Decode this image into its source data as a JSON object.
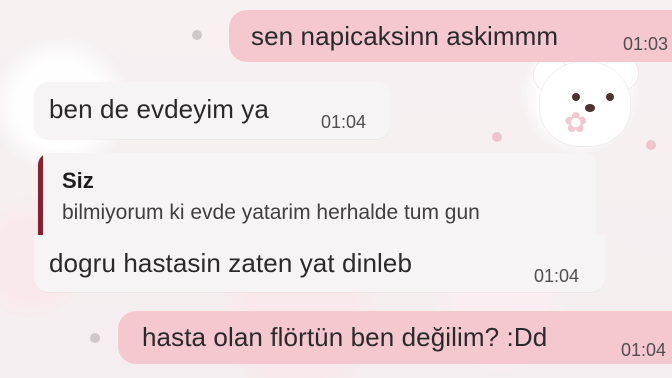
{
  "messages": {
    "m1": {
      "text": "sen napicaksinn askimmm",
      "time": "01:03"
    },
    "m2": {
      "text": "ben de evdeyim ya",
      "time": "01:04"
    },
    "m3": {
      "reply_author": "Siz",
      "reply_text": "bilmiyorum ki evde yatarim herhalde tum gun",
      "text": "dogru hastasin zaten yat dinleb",
      "time": "01:04"
    },
    "m4": {
      "text": "hasta olan flörtün ben değilim? :Dd",
      "time": "01:04"
    }
  }
}
